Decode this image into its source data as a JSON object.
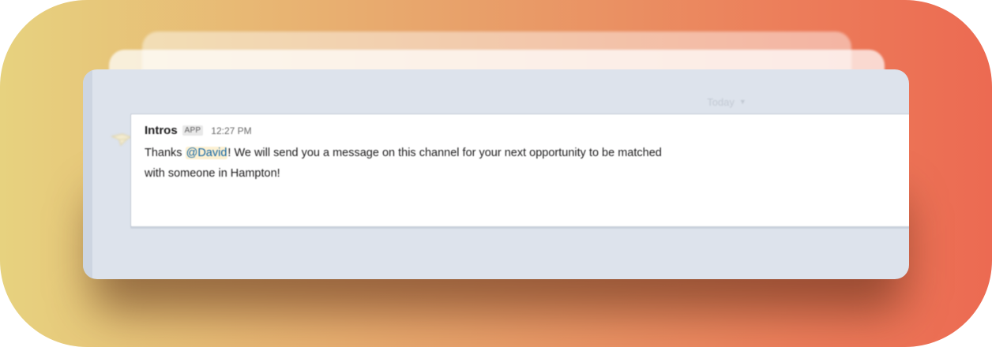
{
  "colors": {
    "gradient_left": "#e7d27f",
    "gradient_right": "#ec6a52",
    "card_bg": "#dde3ec",
    "mention_text": "#1264a3",
    "mention_bg": "#fdf1d2"
  },
  "divider": {
    "label": "Today",
    "icon": "chevron-down-icon"
  },
  "message": {
    "sender": "Intros",
    "badge": "APP",
    "time": "12:27 PM",
    "avatar_icon": "bot-avatar-icon",
    "text_before": "Thanks ",
    "mention": "@David",
    "text_after": "! We will send you a message on this channel for your next opportunity to be matched with someone in Hampton!"
  }
}
